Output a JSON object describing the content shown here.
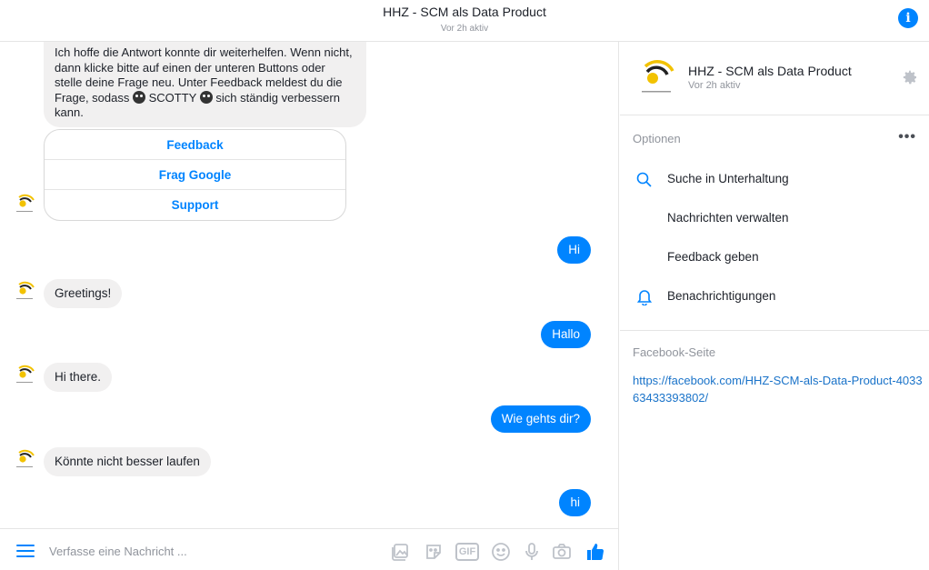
{
  "header": {
    "title": "HHZ - SCM als Data Product",
    "subtitle": "Vor 2h aktiv",
    "info_icon": "info-icon"
  },
  "chat": {
    "first_message": "Ich hoffe die Antwort konnte dir weiterhelfen. Wenn nicht, dann klicke bitte auf einen der unteren Buttons oder stelle deine Frage neu. Unter Feedback meldest du die Frage, sodass",
    "first_message_bot": "SCOTTY",
    "first_message_end": "sich ständig verbessern kann.",
    "quick_replies": [
      "Feedback",
      "Frag Google",
      "Support"
    ],
    "messages": [
      {
        "from": "user",
        "text": "Hi"
      },
      {
        "from": "bot",
        "text": "Greetings!"
      },
      {
        "from": "user",
        "text": "Hallo"
      },
      {
        "from": "bot",
        "text": "Hi there."
      },
      {
        "from": "user",
        "text": "Wie gehts dir?"
      },
      {
        "from": "bot",
        "text": "Könnte nicht besser laufen"
      },
      {
        "from": "user",
        "text": "hi"
      }
    ]
  },
  "composer": {
    "placeholder": "Verfasse eine Nachricht ...",
    "gif_label": "GIF",
    "icons": [
      "menu-icon",
      "image-icon",
      "sticker-icon",
      "gif-icon",
      "emoji-icon",
      "microphone-icon",
      "camera-icon",
      "thumbs-up-icon"
    ]
  },
  "panel": {
    "name": "HHZ - SCM als Data Product",
    "status": "Vor 2h aktiv",
    "options_title": "Optionen",
    "options": [
      {
        "label": "Suche in Unterhaltung",
        "icon": "search-icon"
      },
      {
        "label": "Nachrichten verwalten",
        "icon": ""
      },
      {
        "label": "Feedback geben",
        "icon": ""
      },
      {
        "label": "Benachrichtigungen",
        "icon": "bell-icon"
      }
    ],
    "facebook_title": "Facebook-Seite",
    "facebook_url": "https://facebook.com/HHZ-SCM-als-Data-Product-403363433393802/"
  },
  "colors": {
    "accent": "#0084ff",
    "incoming_bubble": "#f1f0f0",
    "muted_text": "#90949c"
  }
}
